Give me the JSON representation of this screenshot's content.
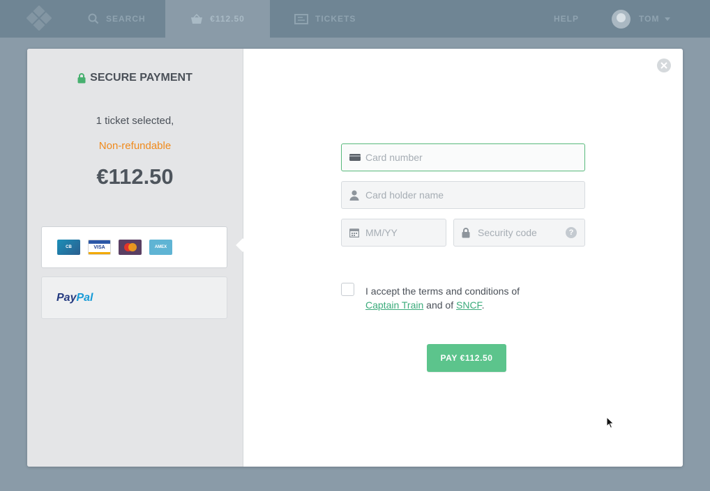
{
  "nav": {
    "search_label": "SEARCH",
    "cart_amount": "€112.50",
    "tickets_label": "TICKETS",
    "help_label": "HELP",
    "user_name": "TOM"
  },
  "summary": {
    "title": "SECURE PAYMENT",
    "tickets_selected": "1 ticket selected,",
    "refund_status": "Non-refundable",
    "price": "€112.50",
    "card_logos": [
      "CB",
      "VISA",
      "MC",
      "AMEX"
    ],
    "paypal_label_a": "Pay",
    "paypal_label_b": "Pal"
  },
  "form": {
    "card_number_placeholder": "Card number",
    "card_holder_placeholder": "Card holder name",
    "expiry_placeholder": "MM/YY",
    "security_code_placeholder": "Security code",
    "security_help": "?",
    "terms_prefix": "I accept the terms and conditions of",
    "terms_link_1": "Captain Train",
    "terms_middle": "and of",
    "terms_link_2": "SNCF",
    "terms_suffix": ".",
    "pay_button": "PAY €112.50"
  },
  "colors": {
    "accent_green": "#5cc48c",
    "warning_orange": "#f08a1c",
    "nav_bg": "#6f8594",
    "page_bg": "#8a9ba8"
  },
  "icons": [
    "logo-icon",
    "search-icon",
    "basket-icon",
    "ticket-icon",
    "lock-icon",
    "credit-card-icon",
    "user-icon",
    "calendar-icon",
    "close-icon",
    "help-icon",
    "mouse-cursor-icon"
  ]
}
